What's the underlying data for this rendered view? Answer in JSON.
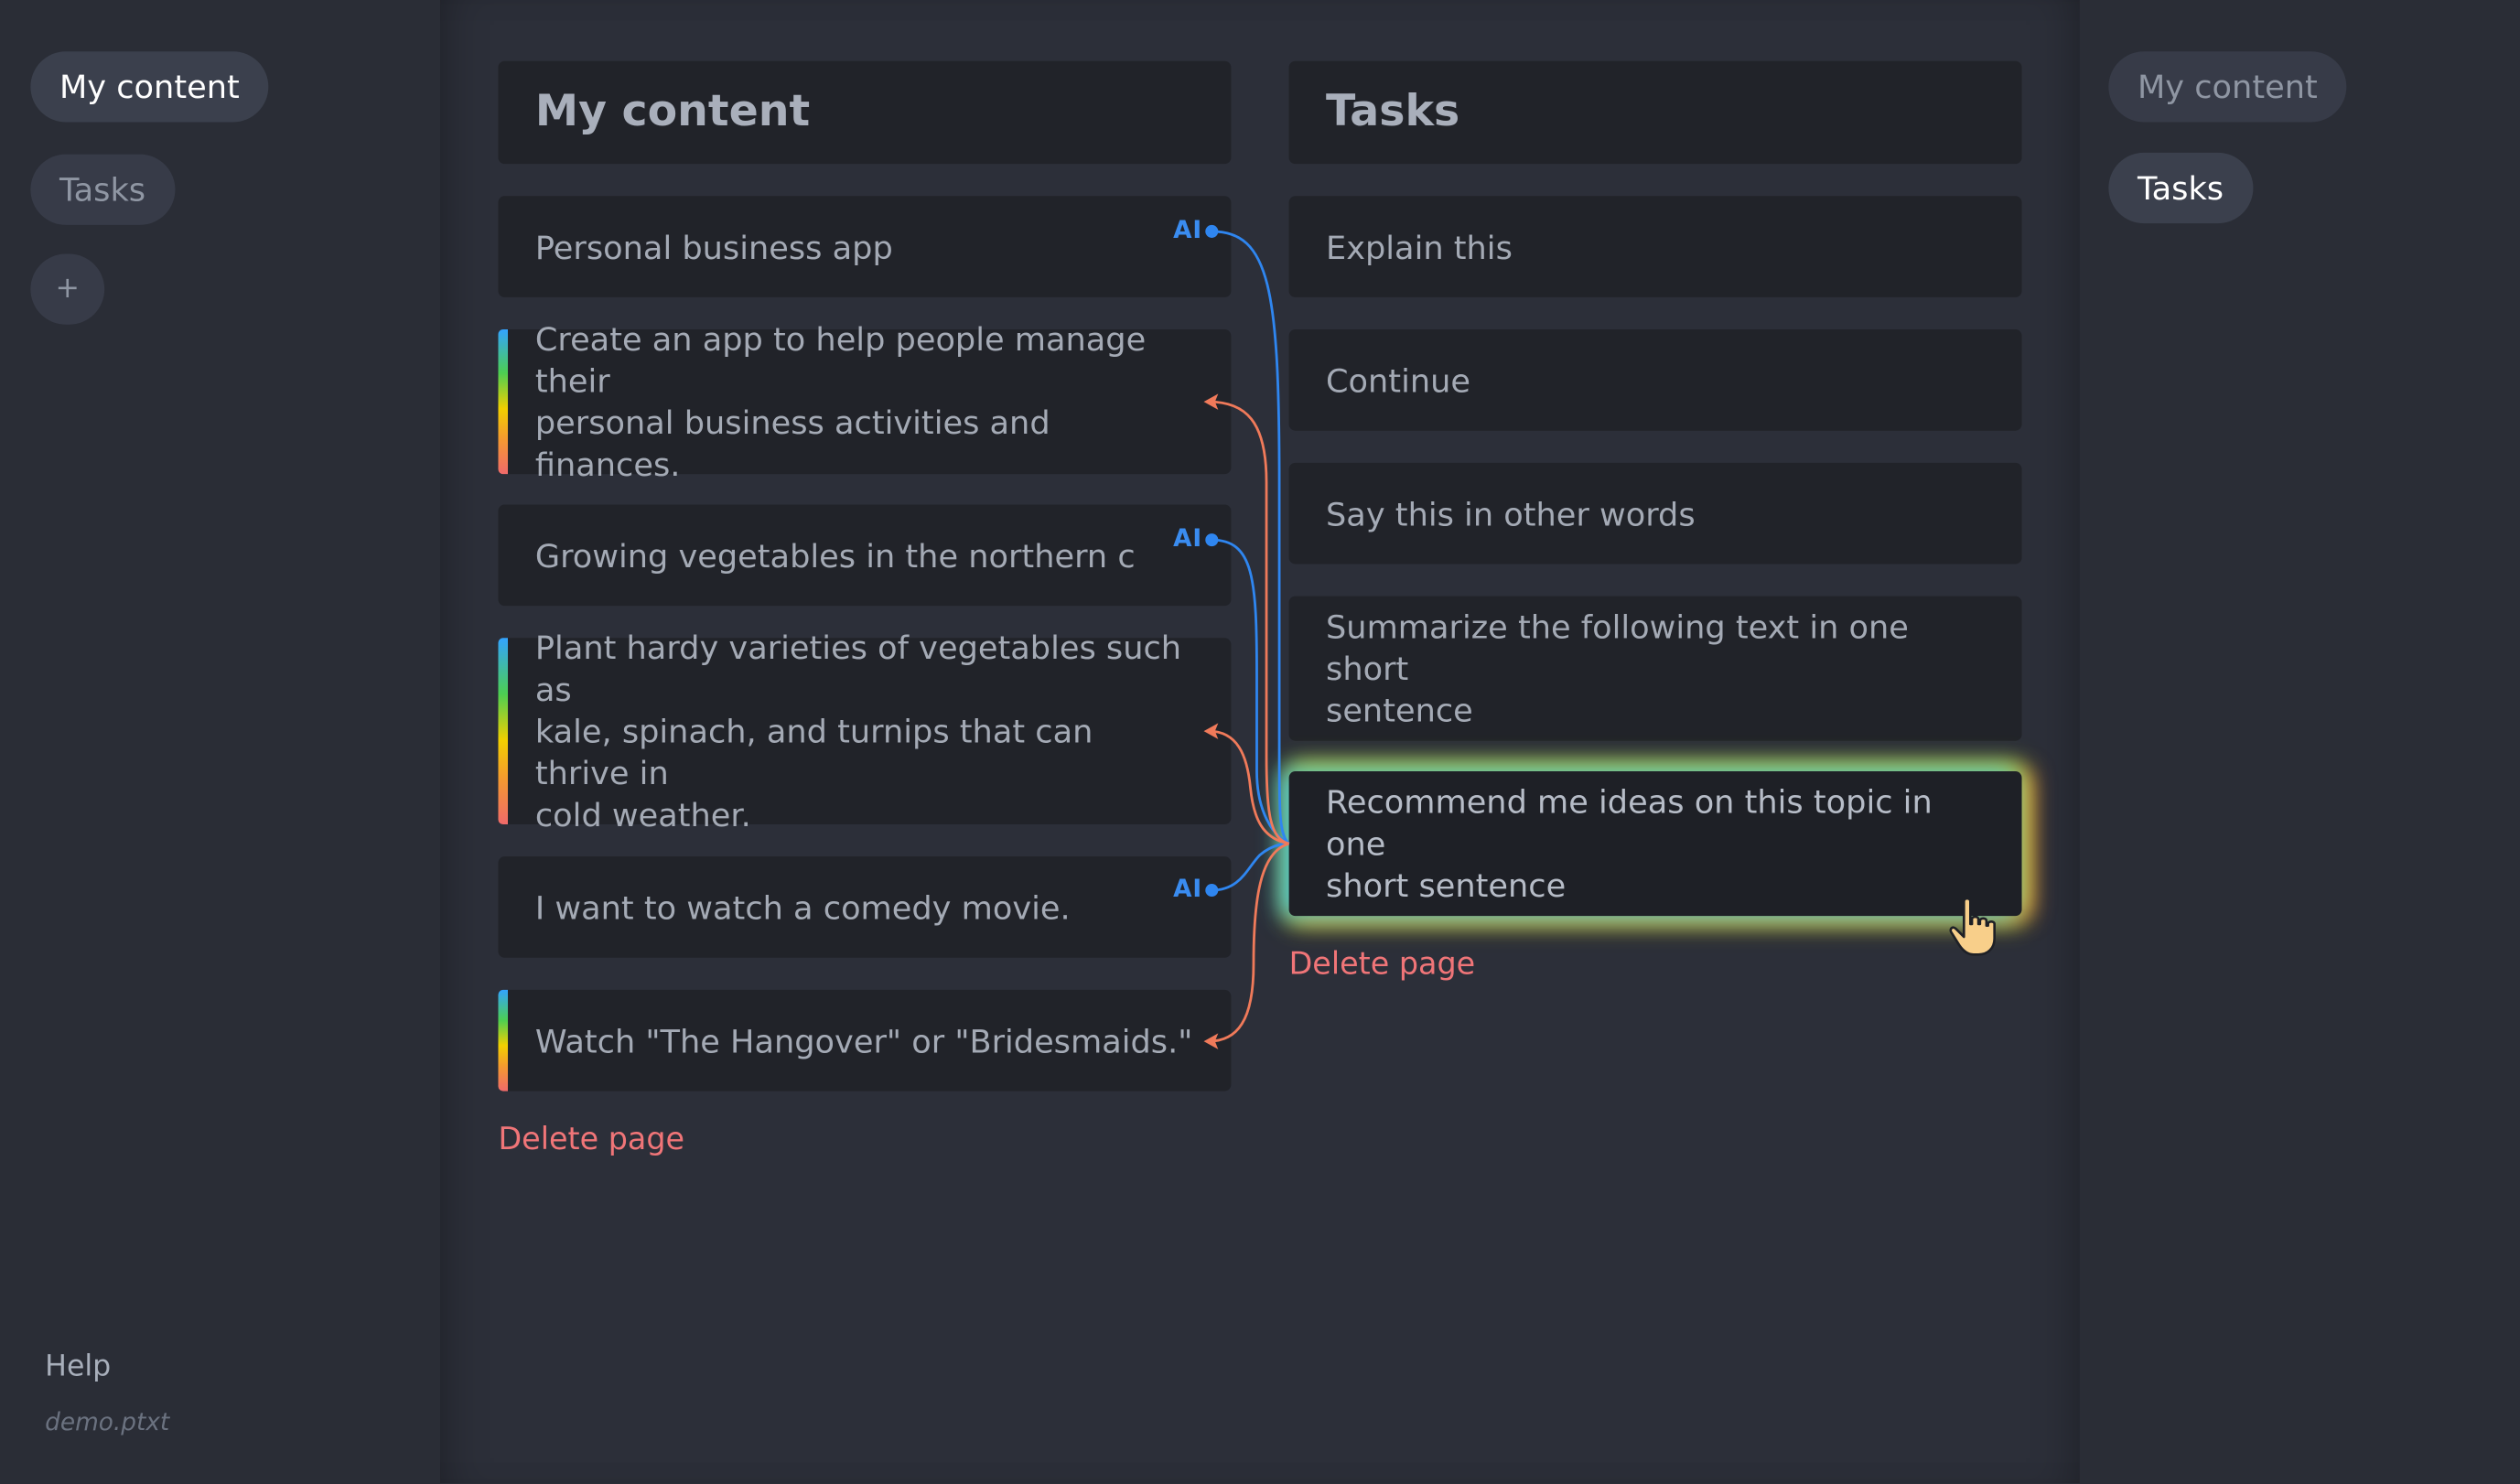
{
  "left_sidebar": {
    "nav": [
      {
        "label": "My content"
      },
      {
        "label": "Tasks"
      }
    ],
    "add_label": "+",
    "help_label": "Help",
    "filename": "demo.ptxt"
  },
  "right_sidebar": {
    "nav": [
      {
        "label": "My content"
      },
      {
        "label": "Tasks"
      }
    ]
  },
  "content_column": {
    "title": "My content",
    "cards": [
      {
        "text": "Personal business app",
        "ai": "AI"
      },
      {
        "text": "Create an app to help people manage their\npersonal business activities and finances."
      },
      {
        "text": "Growing vegetables in the northern clima",
        "ai": "AI"
      },
      {
        "text": "Plant hardy varieties of vegetables such as\nkale, spinach, and turnips that can thrive in\ncold weather."
      },
      {
        "text": "I want to watch a comedy movie.",
        "ai": "AI"
      },
      {
        "text": "Watch \"The Hangover\" or \"Bridesmaids.\""
      }
    ],
    "delete_label": "Delete page"
  },
  "tasks_column": {
    "title": "Tasks",
    "cards": [
      {
        "text": "Explain this"
      },
      {
        "text": "Continue"
      },
      {
        "text": "Say this in other words"
      },
      {
        "text": "Summarize the following text in one short\nsentence"
      },
      {
        "text": "Recommend me ideas on this topic in one\nshort sentence"
      }
    ],
    "delete_label": "Delete page"
  },
  "colors": {
    "ai_link": "#2f86f0",
    "result_link": "#f07a5a",
    "delete": "#f07578"
  }
}
